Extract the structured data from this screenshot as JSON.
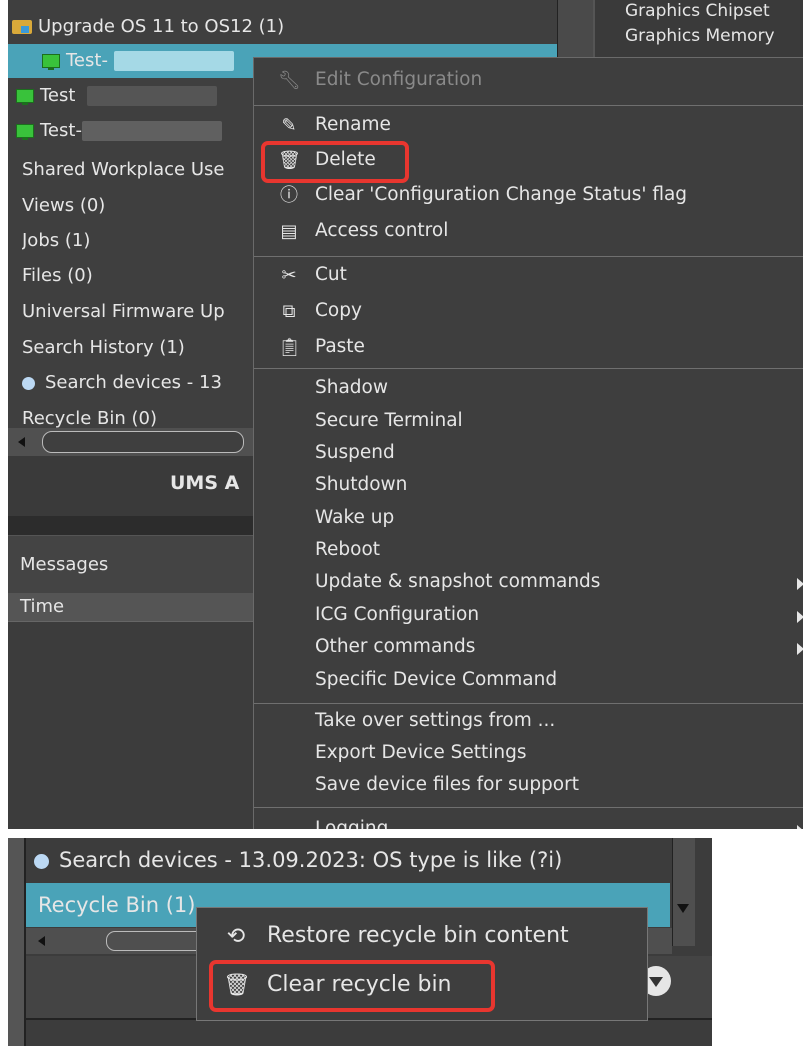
{
  "tree": {
    "items": [
      {
        "label": "Upgrade OS 11 to OS12 (1)",
        "icon": "folder-icon"
      },
      {
        "label": "Test-",
        "icon": "monitor-icon"
      },
      {
        "label": "Test",
        "icon": "monitor-icon"
      },
      {
        "label": "Test-",
        "icon": "monitor-icon"
      },
      {
        "label": "Shared Workplace Use"
      },
      {
        "label": "Views (0)"
      },
      {
        "label": "Jobs (1)"
      },
      {
        "label": "Files (0)"
      },
      {
        "label": "Universal Firmware Up"
      },
      {
        "label": "Search History (1)"
      },
      {
        "label": "Search devices - 13",
        "icon": "search-icon"
      },
      {
        "label": "Recycle Bin (0)"
      }
    ]
  },
  "info": {
    "line1": "Graphics Chipset",
    "line2": "Graphics Memory"
  },
  "ums_label": "UMS A",
  "messages": {
    "title": "Messages",
    "column_time": "Time"
  },
  "context_menu": {
    "items": [
      {
        "label": "Edit Configuration",
        "icon": "wrench-icon",
        "disabled": true
      },
      {
        "label": "Rename",
        "icon": "pencil-icon"
      },
      {
        "label": "Delete",
        "icon": "trash-icon",
        "highlighted": true
      },
      {
        "label": "Clear 'Configuration Change Status' flag",
        "icon": "info-circle-icon"
      },
      {
        "label": "Access control",
        "icon": "id-card-icon"
      },
      {
        "label": "Cut",
        "icon": "scissors-icon"
      },
      {
        "label": "Copy",
        "icon": "copy-icon"
      },
      {
        "label": "Paste",
        "icon": "clipboard-icon"
      },
      {
        "label": "Shadow"
      },
      {
        "label": "Secure Terminal"
      },
      {
        "label": "Suspend"
      },
      {
        "label": "Shutdown"
      },
      {
        "label": "Wake up"
      },
      {
        "label": "Reboot"
      },
      {
        "label": "Update & snapshot commands",
        "submenu": true
      },
      {
        "label": "ICG Configuration",
        "submenu": true
      },
      {
        "label": "Other commands",
        "submenu": true
      },
      {
        "label": "Specific Device Command"
      },
      {
        "label": "Take over settings from ..."
      },
      {
        "label": "Export Device Settings"
      },
      {
        "label": "Save device files for support"
      },
      {
        "label": "Logging",
        "submenu": true
      }
    ]
  },
  "bottom": {
    "search_item": "Search devices - 13.09.2023: OS type is like (?i)",
    "recycle_item": "Recycle Bin (1)",
    "menu": [
      {
        "label": "Restore recycle bin content",
        "icon": "restore-icon"
      },
      {
        "label": "Clear recycle bin",
        "icon": "trash-icon",
        "highlighted": true
      }
    ]
  },
  "colors": {
    "highlight": "#e8362f",
    "selection": "#4aa3b8",
    "menu_bg": "#3e3e3e"
  }
}
